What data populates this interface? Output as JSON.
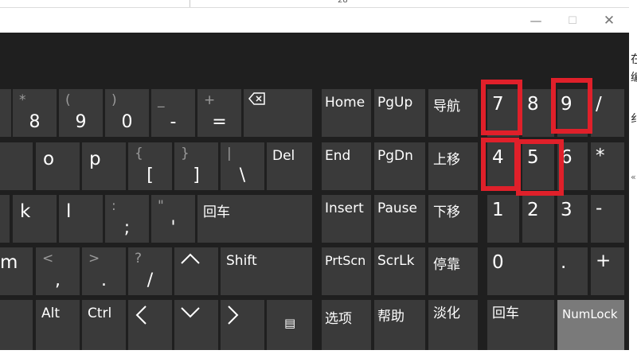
{
  "background_strip": {
    "fragment": "28"
  },
  "window": {
    "minimize_symbol": "—",
    "maximize_symbol": "☐",
    "close_symbol": "✕"
  },
  "right_edge": [
    "在",
    "编",
    "纟",
    "«"
  ],
  "keys": {
    "k8": {
      "secondary": "*",
      "primary": "8"
    },
    "k9": {
      "secondary": "(",
      "primary": "9"
    },
    "k0": {
      "secondary": ")",
      "primary": "0"
    },
    "minus": {
      "secondary": "_",
      "primary": "-"
    },
    "equals": {
      "secondary": "+",
      "primary": "="
    },
    "backspace": {
      "icon": "backspace-icon"
    },
    "o": "o",
    "p": "p",
    "lbracket": {
      "secondary": "{",
      "primary": "["
    },
    "rbracket": {
      "secondary": "}",
      "primary": "]"
    },
    "backslash": {
      "secondary": "|",
      "primary": "\\"
    },
    "del": "Del",
    "k": "k",
    "l": "l",
    "semicolon": {
      "secondary": ":",
      "primary": ";"
    },
    "quote": {
      "secondary": "\"",
      "primary": "'"
    },
    "enter": "回车",
    "m": "m",
    "comma": {
      "secondary": "<",
      "primary": ","
    },
    "period": {
      "secondary": ">",
      "primary": "."
    },
    "slash": {
      "secondary": "?",
      "primary": "/"
    },
    "up": {
      "icon": "arrow-up-icon"
    },
    "shift": "Shift",
    "alt": "Alt",
    "ctrl": "Ctrl",
    "left": {
      "icon": "arrow-left-icon"
    },
    "down": {
      "icon": "arrow-down-icon"
    },
    "right": {
      "icon": "arrow-right-icon"
    },
    "menu": {
      "icon": "menu-icon",
      "glyph": "▤"
    },
    "home": "Home",
    "pgup": "PgUp",
    "nav": "导航",
    "end": "End",
    "pgdn": "PgDn",
    "moveup": "上移",
    "insert": "Insert",
    "pause": "Pause",
    "movedown": "下移",
    "prtscn": "PrtScn",
    "scrlk": "ScrLk",
    "dock": "停靠",
    "options": "选项",
    "help": "帮助",
    "fade": "淡化",
    "num7": "7",
    "num8": "8",
    "num9": "9",
    "numdiv": "/",
    "num4": "4",
    "num5": "5",
    "num6": "6",
    "nummul": "*",
    "num1": "1",
    "num2": "2",
    "num3": "3",
    "numsub": "-",
    "num0": "0",
    "numdot": ".",
    "numadd": "+",
    "numenter": "回车",
    "numlock": "NumLock"
  },
  "colors": {
    "keyboard_bg": "#1f1f1f",
    "key_bg": "#3a3a3a",
    "numlock_active_bg": "#7a7a7a",
    "highlight": "#e0202a"
  }
}
